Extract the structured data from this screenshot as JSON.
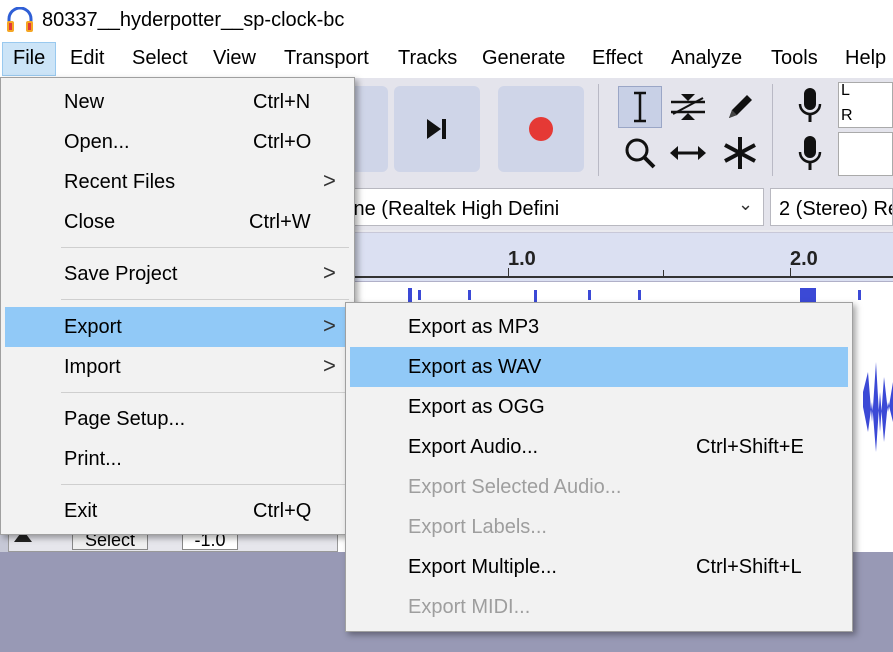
{
  "window": {
    "title": "80337__hyderpotter__sp-clock-bc"
  },
  "menubar": {
    "items": [
      "File",
      "Edit",
      "Select",
      "View",
      "Transport",
      "Tracks",
      "Generate",
      "Effect",
      "Analyze",
      "Tools",
      "Help"
    ]
  },
  "device": {
    "input_device": "ophone (Realtek High Defini",
    "channels": "2 (Stereo) Re"
  },
  "meter": {
    "left_channel": "L",
    "right_channel": "R"
  },
  "ruler": {
    "marks": [
      "1.0",
      "2.0"
    ]
  },
  "track": {
    "select_label": "Select",
    "gain_value": "-1.0"
  },
  "file_menu": {
    "new": {
      "label": "New",
      "shortcut": "Ctrl+N"
    },
    "open": {
      "label": "Open...",
      "shortcut": "Ctrl+O"
    },
    "recent": {
      "label": "Recent Files"
    },
    "close": {
      "label": "Close",
      "shortcut": "Ctrl+W"
    },
    "save_project": {
      "label": "Save Project"
    },
    "export": {
      "label": "Export"
    },
    "import": {
      "label": "Import"
    },
    "page_setup": {
      "label": "Page Setup..."
    },
    "print": {
      "label": "Print..."
    },
    "exit": {
      "label": "Exit",
      "shortcut": "Ctrl+Q"
    },
    "submenu_arrow": ">"
  },
  "export_menu": {
    "mp3": {
      "label": "Export as MP3"
    },
    "wav": {
      "label": "Export as WAV"
    },
    "ogg": {
      "label": "Export as OGG"
    },
    "audio": {
      "label": "Export Audio...",
      "shortcut": "Ctrl+Shift+E"
    },
    "selected_audio": {
      "label": "Export Selected Audio..."
    },
    "labels": {
      "label": "Export Labels..."
    },
    "multiple": {
      "label": "Export Multiple...",
      "shortcut": "Ctrl+Shift+L"
    },
    "midi": {
      "label": "Export MIDI..."
    }
  },
  "colors": {
    "highlight": "#91c9f7",
    "record": "#e53935",
    "waveform": "#3b49d6",
    "disabled_text": "#9e9e9e"
  },
  "icons": {
    "app": "audacity-headphones-icon",
    "skip_end": "skip-to-end-icon",
    "record": "record-icon",
    "ibeam": "selection-tool-icon",
    "envelope": "envelope-tool-icon",
    "draw": "pencil-icon",
    "zoom": "magnifier-icon",
    "timeshift": "timeshift-icon",
    "multi": "multi-tool-icon",
    "mic": "microphone-icon"
  }
}
